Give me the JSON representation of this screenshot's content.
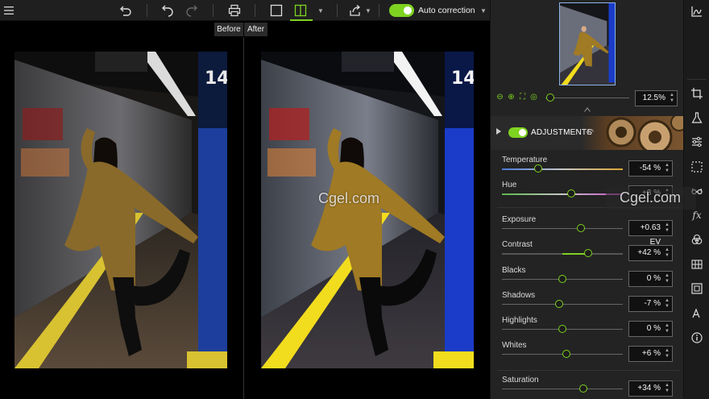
{
  "toolbar": {
    "auto_correction_label": "Auto correction",
    "auto_correction_on": true,
    "icons": [
      "menu-icon",
      "undo-all-icon",
      "undo-icon",
      "redo-icon",
      "print-icon",
      "single-view-icon",
      "split-view-icon",
      "chevron-down-icon",
      "export-icon",
      "chevron-down-icon",
      "chevron-down-icon"
    ]
  },
  "compare": {
    "before_label": "Before",
    "after_label": "After"
  },
  "panel": {
    "zoom_value": "12.5%",
    "zoom_fraction": 0.06,
    "adjustments_title": "ADJUSTMENTS",
    "adjustments_on": true,
    "sliders": [
      {
        "label": "Temperature",
        "value": "-54 %",
        "position": 0.3,
        "track": "temperature"
      },
      {
        "label": "Hue",
        "value": "+3 %",
        "position": 0.57,
        "track": "hue"
      },
      {
        "label": "Exposure",
        "value": "+0.63 EV",
        "position": 0.65,
        "track": "plain"
      },
      {
        "label": "Contrast",
        "value": "+42 %",
        "position": 0.71,
        "track": "green"
      },
      {
        "label": "Blacks",
        "value": "0 %",
        "position": 0.5,
        "track": "plain"
      },
      {
        "label": "Shadows",
        "value": "-7 %",
        "position": 0.47,
        "track": "plain"
      },
      {
        "label": "Highlights",
        "value": "0 %",
        "position": 0.5,
        "track": "plain"
      },
      {
        "label": "Whites",
        "value": "+6 %",
        "position": 0.53,
        "track": "plain"
      },
      {
        "label": "Saturation",
        "value": "+34 %",
        "position": 0.67,
        "track": "plain"
      }
    ]
  },
  "strip": {
    "icons": [
      "histogram-icon",
      "crop-icon",
      "flask-icon",
      "sliders-icon",
      "selection-icon",
      "glasses-icon",
      "fx-icon",
      "color-circles-icon",
      "grid-icon",
      "frame-icon",
      "text-icon",
      "info-icon"
    ]
  },
  "watermark": "Cgel.com",
  "colors": {
    "accent": "#7ed321",
    "panel_bg": "#232323",
    "toolbar_bg": "#1f1f1f"
  }
}
